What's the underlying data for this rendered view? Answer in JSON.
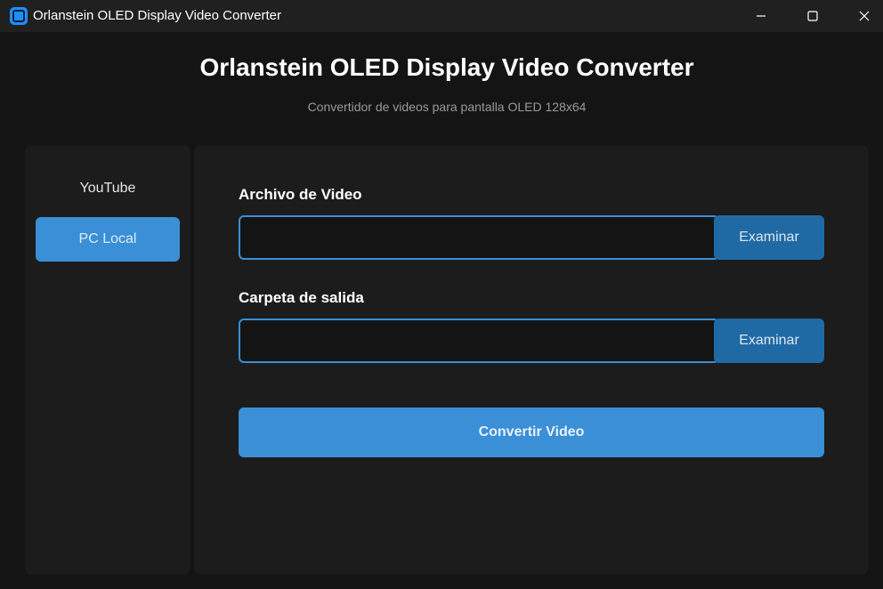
{
  "window": {
    "title": "Orlanstein OLED Display Video Converter",
    "controls": [
      "minimize",
      "maximize",
      "close"
    ]
  },
  "header": {
    "title": "Orlanstein OLED Display Video Converter",
    "subtitle": "Convertidor de videos para pantalla OLED 128x64"
  },
  "sidebar": {
    "items": [
      {
        "label": "YouTube",
        "active": false
      },
      {
        "label": "PC Local",
        "active": true
      }
    ]
  },
  "main": {
    "video_file": {
      "label": "Archivo de Video",
      "value": "",
      "browse_label": "Examinar"
    },
    "output_folder": {
      "label": "Carpeta de salida",
      "value": "",
      "browse_label": "Examinar"
    },
    "convert_label": "Convertir Video"
  },
  "colors": {
    "accent": "#3a8fd6",
    "browse_button": "#1f6aa5",
    "background": "#141414",
    "panel": "#1c1c1c",
    "app_icon": "#1e90ff"
  },
  "icons": {
    "app": "app-icon",
    "minimize": "minimize-icon",
    "maximize": "maximize-icon",
    "close": "close-icon"
  }
}
